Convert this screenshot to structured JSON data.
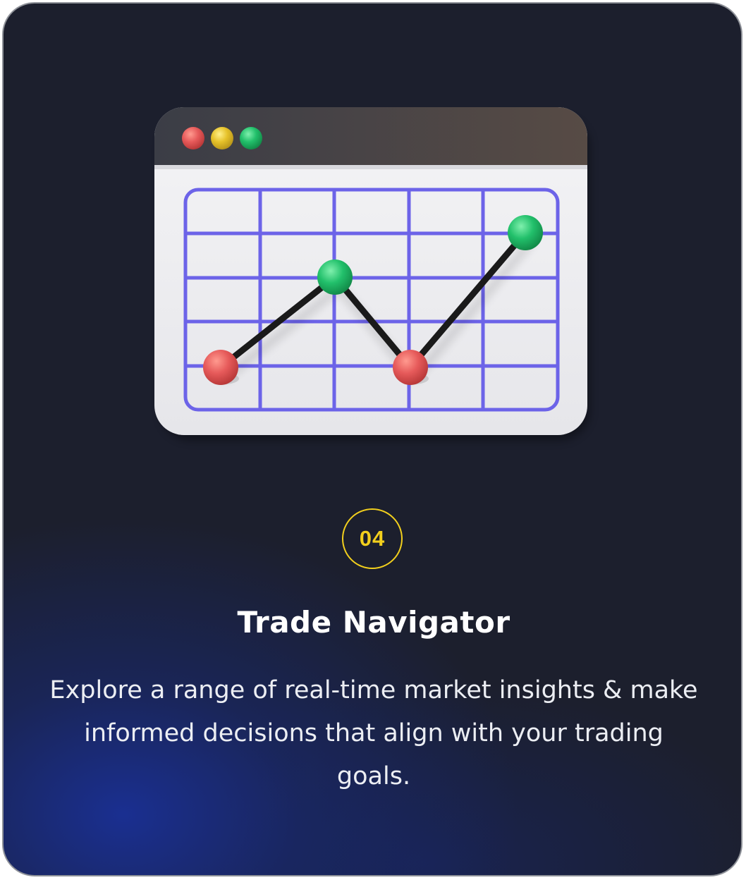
{
  "card": {
    "step_number": "04",
    "title": "Trade Navigator",
    "description": "Explore a range of real-time market insights & make informed decisions that align with your trading goals."
  },
  "illustration": {
    "icon": "chart-window-icon",
    "window_buttons": [
      "close",
      "minimize",
      "maximize"
    ],
    "colors": {
      "title_bar": "#4e4644",
      "window_body": "#efeff1",
      "grid": "#6c63e8",
      "line": "#1a1a1a",
      "point_up": "#22c06b",
      "point_down": "#e65a5a",
      "button_red": "#e05555",
      "button_yellow": "#e6c22a",
      "button_green": "#2fb36a"
    },
    "trend_points": [
      {
        "kind": "down"
      },
      {
        "kind": "up"
      },
      {
        "kind": "down"
      },
      {
        "kind": "up"
      }
    ]
  },
  "theme": {
    "background": "#1c1f2d",
    "glow": "#1a3096",
    "accent": "#f2cf1d",
    "text": "#ffffff"
  }
}
